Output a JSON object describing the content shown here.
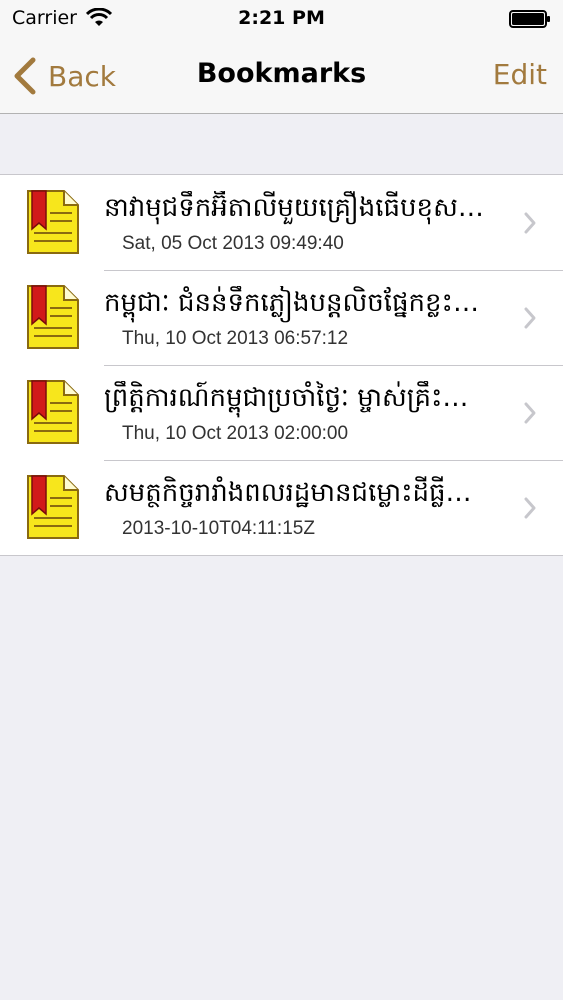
{
  "status_bar": {
    "carrier": "Carrier",
    "time": "2:21 PM"
  },
  "nav": {
    "back_label": "Back",
    "title": "Bookmarks",
    "edit_label": "Edit",
    "accent_color": "#a27a3e"
  },
  "bookmarks": [
    {
      "title": "នាវាមុជទឹកអ៊ីតាលីមួយគ្រឿងធើបខុស…",
      "date": "Sat, 05 Oct 2013 09:49:40",
      "icon": "bookmark-document-icon"
    },
    {
      "title": "កម្ពុជាៈ ជំនន់ទឹកភ្លៀងបន្តលិចផ្នែកខ្លះ…",
      "date": "Thu, 10 Oct 2013 06:57:12",
      "icon": "bookmark-document-icon"
    },
    {
      "title": "ព្រឹត្តិការណ៍កម្ពុជាប្រចាំថ្ងៃៈ ម្ចាស់គ្រឹះ…",
      "date": "Thu, 10 Oct 2013 02:00:00",
      "icon": "bookmark-document-icon"
    },
    {
      "title": "សមត្ថកិច្ចរារាំងពលរដ្ឋមានជម្លោះដីធ្លីជា…",
      "date": "2013-10-10T04:11:15Z",
      "icon": "bookmark-document-icon"
    }
  ]
}
